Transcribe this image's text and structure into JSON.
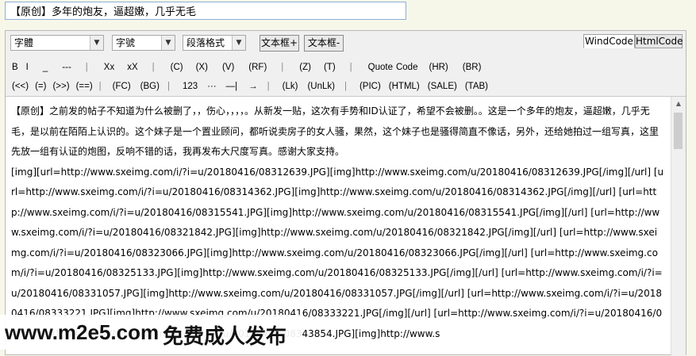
{
  "title_input": {
    "value": "【原创】多年的炮友，逼超嫩，几乎无毛"
  },
  "toolbar": {
    "font_select": "字體",
    "size_select": "字號",
    "paragraph_select": "段落格式",
    "textbox_plus": "文本框+",
    "textbox_minus": "文本框-",
    "tab_windcode": "WindCode",
    "tab_htmlcode": "HtmlCode",
    "row1": [
      "B",
      "I",
      "_",
      "---",
      "|",
      "Xx",
      "xX",
      "|",
      "(C)",
      "(X)",
      "(V)",
      "(RF)",
      "|",
      "(Z)",
      "(T)",
      "|",
      "Quote",
      "Code",
      "(HR)",
      "(BR)"
    ],
    "row2": [
      "(<<)",
      "(=)",
      "(>>)",
      "(==)",
      "|",
      "(FC)",
      "(BG)",
      "|",
      "123",
      "···",
      "—|",
      "→",
      "|",
      "(Lk)",
      "(UnLk)",
      "|",
      "(PIC)",
      "(HTML)",
      "(SALE)",
      "(TAB)"
    ]
  },
  "content": {
    "paragraph1": "【原创】之前发的帖子不知道为什么被删了，，伤心，，，，。从新发一贴，这次有手势和ID认证了，希望不会被删。。这是一个多年的炮友，逼超嫩，几乎无毛，是以前在陌陌上认识的。这个妹子是一个置业顾问，都听说卖房子的女人骚，果然，这个妹子也是骚得简直不像话，另外，还给她拍过一组写真，这里先放一组有认证的炮图，反响不错的话，我再发布大尺度写真。感谢大家支持。",
    "paragraph2": "[img][url=http://www.sxeimg.com/i/?i=u/20180416/08312639.JPG][img]http://www.sxeimg.com/u/20180416/08312639.JPG[/img][/url] [url=http://www.sxeimg.com/i/?i=u/20180416/08314362.JPG][img]http://www.sxeimg.com/u/20180416/08314362.JPG[/img][/url] [url=http://www.sxeimg.com/i/?i=u/20180416/08315541.JPG][img]http://www.sxeimg.com/u/20180416/08315541.JPG[/img][/url] [url=http://www.sxeimg.com/i/?i=u/20180416/08321842.JPG][img]http://www.sxeimg.com/u/20180416/08321842.JPG[/img][/url] [url=http://www.sxeimg.com/i/?i=u/20180416/08323066.JPG][img]http://www.sxeimg.com/u/20180416/08323066.JPG[/img][/url] [url=http://www.sxeimg.com/i/?i=u/20180416/08325133.JPG][img]http://www.sxeimg.com/u/20180416/08325133.JPG[/img][/url] [url=http://www.sxeimg.com/i/?i=u/20180416/08331057.JPG][img]http://www.sxeimg.com/u/20180416/08331057.JPG[/img][/url] [url=http://www.sxeimg.com/i/?i=u/20180416/08333221.JPG][img]http://www.sxeimg.com/u/20180416/08333221.JPG[/img][/url] [url=http://www.sxeimg.com/i/?i=u/20180416/08341[/url] [url=http://www.sxeimg.com/i/?i=u/20180416/08343854.JPG][img]http://www.s"
  },
  "watermark": {
    "site": "www.m2e5.com",
    "slogan": "免费成人发布"
  }
}
